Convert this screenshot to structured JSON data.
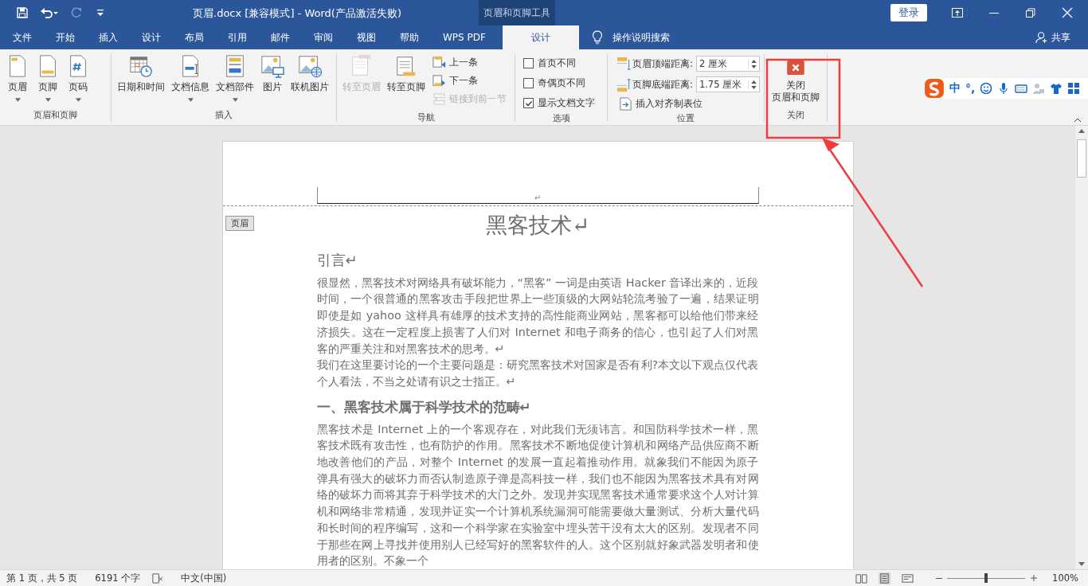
{
  "title_bar": {
    "title": "页眉.docx [兼容模式]  -  Word(产品激活失败)",
    "context_tool": "页眉和页脚工具",
    "login": "登录"
  },
  "tabs": [
    {
      "label": "文件",
      "selected": false
    },
    {
      "label": "开始",
      "selected": false
    },
    {
      "label": "插入",
      "selected": false
    },
    {
      "label": "设计",
      "selected": false
    },
    {
      "label": "布局",
      "selected": false
    },
    {
      "label": "引用",
      "selected": false
    },
    {
      "label": "邮件",
      "selected": false
    },
    {
      "label": "审阅",
      "selected": false
    },
    {
      "label": "视图",
      "selected": false
    },
    {
      "label": "帮助",
      "selected": false
    },
    {
      "label": "WPS PDF",
      "selected": false
    },
    {
      "label": "设计",
      "selected": true
    }
  ],
  "search": "操作说明搜索",
  "share": "共享",
  "ribbon": [
    {
      "label": "页眉和页脚",
      "items": [
        {
          "kind": "large",
          "label": "页眉",
          "dropdown": true,
          "disabled": false
        },
        {
          "kind": "large",
          "label": "页脚",
          "dropdown": true,
          "disabled": false
        },
        {
          "kind": "large",
          "label": "页码",
          "dropdown": true,
          "disabled": false
        }
      ]
    },
    {
      "label": "插入",
      "items": [
        {
          "kind": "large",
          "label": "日期和时间",
          "dropdown": false,
          "disabled": false
        },
        {
          "kind": "large",
          "label": "文档信息",
          "dropdown": true,
          "disabled": false
        },
        {
          "kind": "large",
          "label": "文档部件",
          "dropdown": true,
          "disabled": false
        },
        {
          "kind": "large",
          "label": "图片",
          "dropdown": false,
          "disabled": false
        },
        {
          "kind": "large",
          "label": "联机图片",
          "dropdown": false,
          "disabled": false
        }
      ]
    },
    {
      "label": "导航",
      "items": [
        {
          "kind": "large",
          "label": "转至页眉",
          "dropdown": false,
          "disabled": true
        },
        {
          "kind": "large",
          "label": "转至页脚",
          "dropdown": false,
          "disabled": false
        },
        {
          "kind": "small",
          "label": "上一条",
          "disabled": false
        },
        {
          "kind": "small",
          "label": "下一条",
          "disabled": false
        },
        {
          "kind": "small",
          "label": "链接到前一节",
          "disabled": true
        }
      ]
    },
    {
      "label": "选项",
      "items": [
        {
          "kind": "checkbox",
          "label": "首页不同",
          "checked": false
        },
        {
          "kind": "checkbox",
          "label": "奇偶页不同",
          "checked": false
        },
        {
          "kind": "checkbox",
          "label": "显示文档文字",
          "checked": true
        }
      ]
    },
    {
      "label": "位置",
      "items": [
        {
          "kind": "spinner",
          "label": "页眉顶端距离:",
          "value": "2 厘米"
        },
        {
          "kind": "spinner",
          "label": "页脚底端距离:",
          "value": "1.75 厘米"
        },
        {
          "kind": "small",
          "label": "插入对齐制表位",
          "disabled": false
        }
      ]
    },
    {
      "label": "关闭",
      "items": [
        {
          "kind": "close",
          "lines": [
            "关闭",
            "页眉和页脚"
          ]
        }
      ]
    }
  ],
  "ime": [
    "中",
    "°,"
  ],
  "document": {
    "header_tag": "页眉",
    "header_mark": "↵",
    "title": "黑客技术↵",
    "blocks": [
      {
        "kind": "heading",
        "text": "引言↵"
      },
      {
        "kind": "para",
        "text": "很显然，黑客技术对网络具有破坏能力，“黑客” 一词是由英语 Hacker 音译出来的，近段时间，一个很普通的黑客攻击手段把世界上一些顶级的大网站轮流考验了一遍，结果证明即使是如 yahoo 这样具有雄厚的技术支持的高性能商业网站，黑客都可以给他们带来经济损失。这在一定程度上损害了人们对 Internet 和电子商务的信心，也引起了人们对黑客的严重关注和对黑客技术的思考。↵"
      },
      {
        "kind": "para",
        "text": "我们在这里要讨论的一个主要问题是：研究黑客技术对国家是否有利?本文以下观点仅代表个人看法，不当之处请有识之士指正。↵"
      },
      {
        "kind": "section",
        "text": "一、黑客技术属于科学技术的范畴↵"
      },
      {
        "kind": "para",
        "text": "黑客技术是 Internet 上的一个客观存在，对此我们无须讳言。和国防科学技术一样，黑客技术既有攻击性，也有防护的作用。黑客技术不断地促使计算机和网络产品供应商不断地改善他们的产品，对整个 Internet 的发展一直起着推动作用。就象我们不能因为原子弹具有强大的破坏力而否认制造原子弹是高科技一样，我们也不能因为黑客技术具有对网络的破坏力而将其弃于科学技术的大门之外。发现并实现黑客技术通常要求这个人对计算机和网络非常精通，发现并证实一个计算机系统漏洞可能需要做大量测试、分析大量代码和长时间的程序编写，这和一个科学家在实验室中埋头苦干没有太大的区别。发现者不同于那些在网上寻找并使用别人已经写好的黑客软件的人。这个区别就好象武器发明者和使用者的区别。不象一个"
      }
    ]
  },
  "status_bar": {
    "page": "第 1 页，共 5 页",
    "words": "6191 个字",
    "language": "中文(中国)",
    "zoom": "100%",
    "zoom_slider": {
      "level": 0.5
    }
  }
}
